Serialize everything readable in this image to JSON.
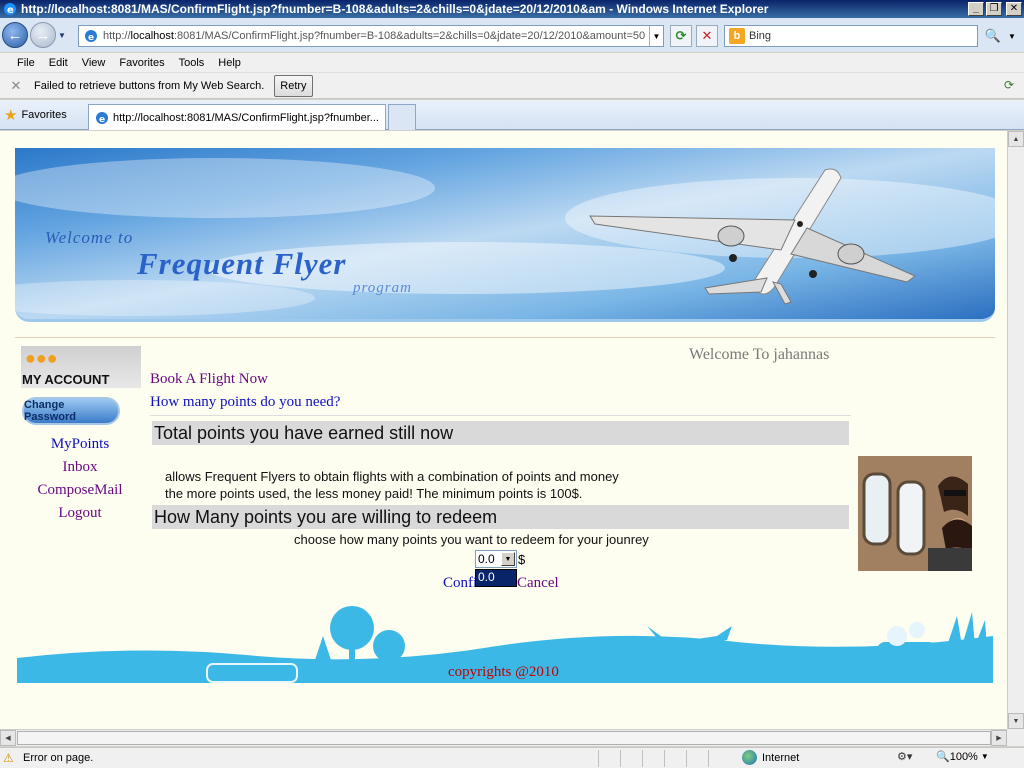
{
  "window": {
    "title": "http://localhost:8081/MAS/ConfirmFlight.jsp?fnumber=B-108&adults=2&chills=0&jdate=20/12/2010&am - Windows Internet Explorer"
  },
  "address": {
    "url_prefix": "http://",
    "url_host": "localhost",
    "url_rest": ":8081/MAS/ConfirmFlight.jsp?fnumber=B-108&adults=2&chills=0&jdate=20/12/2010&amount=50",
    "search_placeholder": "Bing"
  },
  "menu": [
    "File",
    "Edit",
    "View",
    "Favorites",
    "Tools",
    "Help"
  ],
  "infobar": {
    "message": "Failed to retrieve buttons from My Web Search.",
    "retry_label": "Retry"
  },
  "tabs": {
    "favorites_label": "Favorites",
    "active_tab": "http://localhost:8081/MAS/ConfirmFlight.jsp?fnumber..."
  },
  "banner": {
    "welcome": "Welcome to",
    "title": "Frequent Flyer",
    "subtitle": "program"
  },
  "sidebar": {
    "account_label": "MY ACCOUNT",
    "change_password": "Change Password",
    "links": [
      {
        "label": "MyPoints"
      },
      {
        "label": "Inbox"
      },
      {
        "label": "ComposeMail"
      },
      {
        "label": "Logout"
      }
    ]
  },
  "main": {
    "welcome_user": "Welcome To jahannas",
    "book_link": "Book A Flight Now",
    "points_link": "How many points do you need?",
    "section1_title": "Total points you have earned still now",
    "desc_line1": "allows Frequent Flyers to obtain flights with a combination of points and money",
    "desc_line2": "the more points used, the less money paid! The minimum points is 100$.",
    "section2_title": "How Many points you are willing to redeem",
    "choose_text": "choose how many points you want to redeem for your jounrey",
    "select_value": "0.0",
    "select_option": "0.0",
    "currency": "$",
    "confirm_label": "Confirm",
    "cancel_label": "Cancel",
    "copyright": "copyrights @2010"
  },
  "statusbar": {
    "status_text": "Error on page.",
    "zone": "Internet",
    "zoom": "100%"
  }
}
